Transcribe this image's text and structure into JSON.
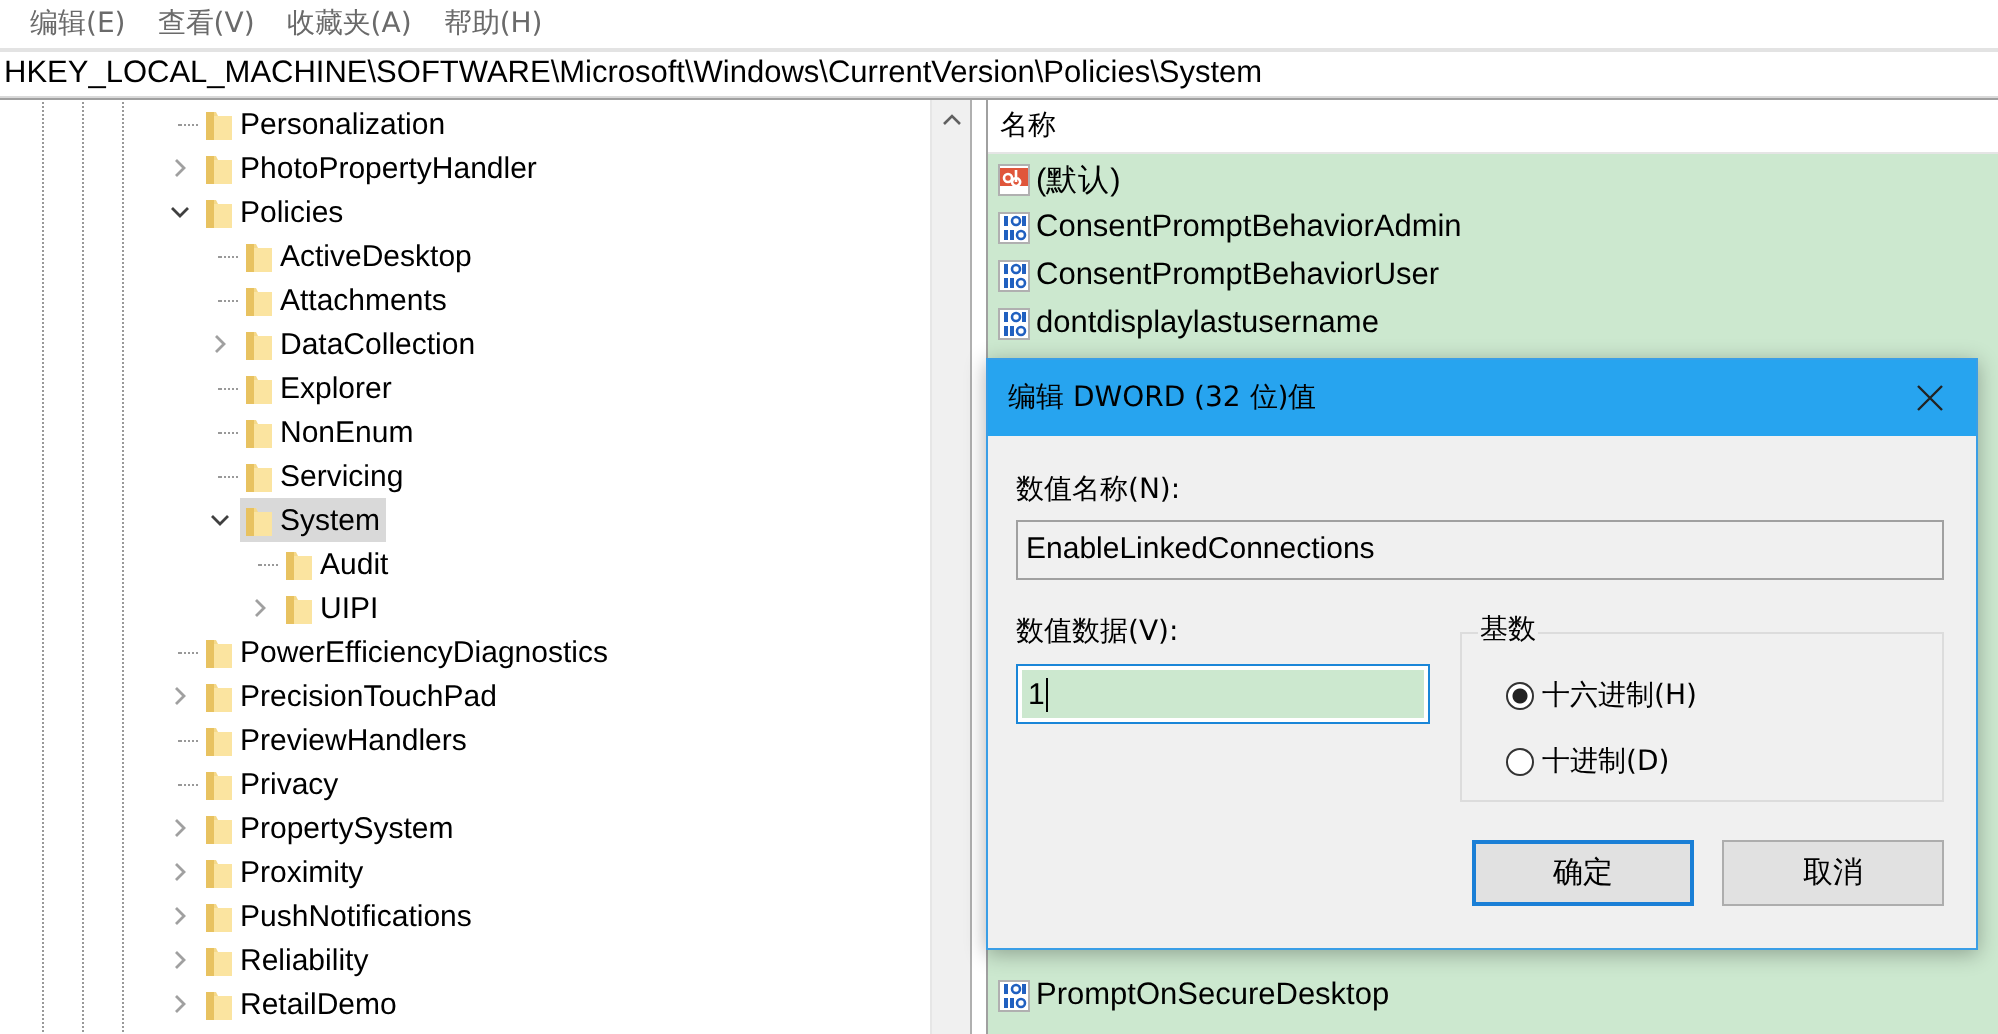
{
  "menu": [
    {
      "label": "编辑(E)"
    },
    {
      "label": "查看(V)"
    },
    {
      "label": "收藏夹(A)"
    },
    {
      "label": "帮助(H)"
    }
  ],
  "address": "HKEY_LOCAL_MACHINE\\SOFTWARE\\Microsoft\\Windows\\CurrentVersion\\Policies\\System",
  "tree": [
    {
      "label": "Personalization",
      "selected": false
    },
    {
      "label": "PhotoPropertyHandler",
      "expanded": false,
      "selected": false
    },
    {
      "label": "Policies",
      "expanded": true,
      "selected": false,
      "children": [
        {
          "label": "ActiveDesktop",
          "selected": false
        },
        {
          "label": "Attachments",
          "selected": false
        },
        {
          "label": "DataCollection",
          "expanded": false,
          "selected": false
        },
        {
          "label": "Explorer",
          "selected": false
        },
        {
          "label": "NonEnum",
          "selected": false
        },
        {
          "label": "Servicing",
          "selected": false
        },
        {
          "label": "System",
          "expanded": true,
          "selected": true,
          "children": [
            {
              "label": "Audit",
              "selected": false
            },
            {
              "label": "UIPI",
              "expanded": false,
              "selected": false
            }
          ]
        }
      ]
    },
    {
      "label": "PowerEfficiencyDiagnostics",
      "selected": false
    },
    {
      "label": "PrecisionTouchPad",
      "expanded": false,
      "selected": false
    },
    {
      "label": "PreviewHandlers",
      "selected": false
    },
    {
      "label": "Privacy",
      "selected": false
    },
    {
      "label": "PropertySystem",
      "expanded": false,
      "selected": false
    },
    {
      "label": "Proximity",
      "expanded": false,
      "selected": false
    },
    {
      "label": "PushNotifications",
      "expanded": false,
      "selected": false
    },
    {
      "label": "Reliability",
      "expanded": false,
      "selected": false
    },
    {
      "label": "RetailDemo",
      "expanded": false,
      "selected": false
    }
  ],
  "values_header": "名称",
  "values": [
    {
      "name": "(默认)",
      "kind": "string"
    },
    {
      "name": "ConsentPromptBehaviorAdmin",
      "kind": "dword"
    },
    {
      "name": "ConsentPromptBehaviorUser",
      "kind": "dword"
    },
    {
      "name": "dontdisplaylastusername",
      "kind": "dword"
    }
  ],
  "values_below_dialog": [
    {
      "name": "PromptOnSecureDesktop",
      "kind": "dword"
    }
  ],
  "dialog": {
    "title": "编辑 DWORD (32 位)值",
    "name_label": "数值名称(N):",
    "name_value": "EnableLinkedConnections",
    "data_label": "数值数据(V):",
    "data_value": "1",
    "base_label": "基数",
    "bases": [
      {
        "label": "十六进制(H)",
        "selected": true
      },
      {
        "label": "十进制(D)",
        "selected": false
      }
    ],
    "buttons": [
      {
        "label": "确定",
        "default": true
      },
      {
        "label": "取消",
        "default": false
      }
    ]
  }
}
